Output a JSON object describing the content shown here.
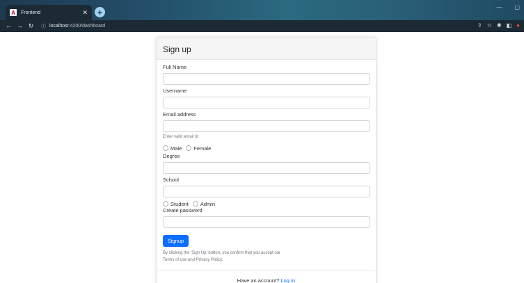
{
  "browser": {
    "tab_title": "Frontend",
    "tab_favicon": "A",
    "url_host": "localhost",
    "url_path": ":4200/dashboard"
  },
  "form": {
    "title": "Sign up",
    "full_name_label": "Full Name",
    "username_label": "Username",
    "email_label": "Email address",
    "email_help": "Enter valid email Id",
    "gender_options": [
      "Male",
      "Female"
    ],
    "degree_label": "Degree",
    "school_label": "School",
    "role_options": [
      "Student",
      "Admin"
    ],
    "password_label": "Create password",
    "signup_button": "Signup",
    "legal_line1": "By clicking the 'Sign Up' button, you confirm that you accept our",
    "legal_line2": "Terms of use and Privacy Policy.",
    "footer_text": "Have an account?",
    "login_link": "Log In"
  },
  "colors": {
    "primary": "#0d6efd",
    "chrome_dark": "#1c2a36"
  }
}
